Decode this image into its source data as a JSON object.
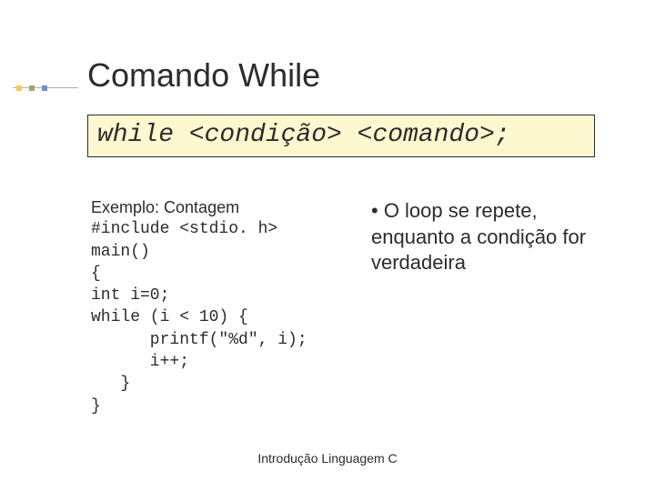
{
  "title": "Comando While",
  "syntax": "while <condição> <comando>;",
  "example": {
    "header": "Exemplo: Contagem",
    "lines": [
      "#include <stdio. h>",
      "main()",
      "{",
      "int i=0;",
      "while (i < 10) {",
      "      printf(\"%d\", i);",
      "      i++;",
      "   }",
      "}"
    ]
  },
  "bullet": "• O loop se repete, enquanto a condição for verdadeira",
  "footer": "Introdução Linguagem C"
}
